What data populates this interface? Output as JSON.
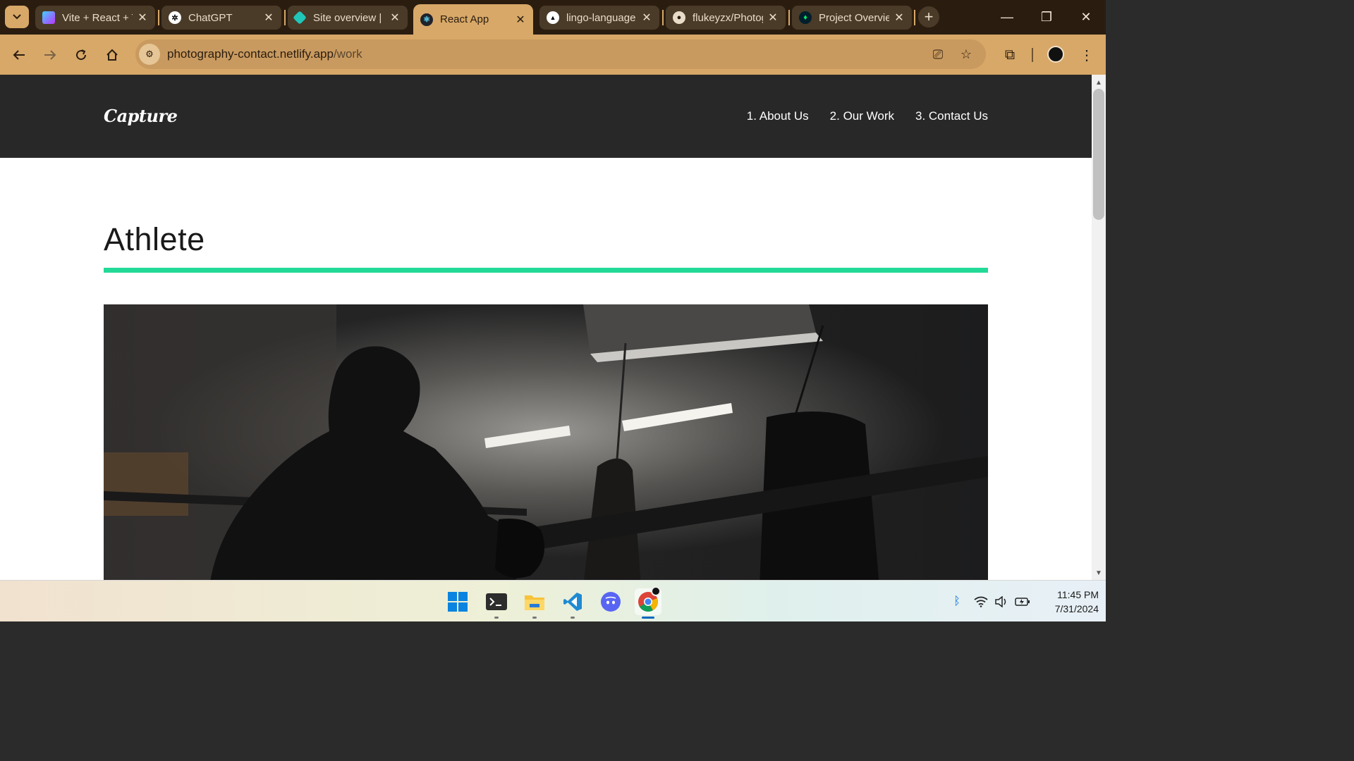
{
  "browser": {
    "tabs": [
      {
        "title": "Vite + React + TS",
        "icon": "vite-icon",
        "active": false
      },
      {
        "title": "ChatGPT",
        "icon": "chatgpt-icon",
        "active": false
      },
      {
        "title": "Site overview | Netlify",
        "icon": "netlify-icon",
        "active": false
      },
      {
        "title": "React App",
        "icon": "react-icon",
        "active": true
      },
      {
        "title": "lingo-language",
        "icon": "vercel-icon",
        "active": false
      },
      {
        "title": "flukeyzx/Photography",
        "icon": "github-icon",
        "active": false
      },
      {
        "title": "Project Overview",
        "icon": "mongodb-icon",
        "active": false
      }
    ],
    "url_host": "photography-contact.netlify.app",
    "url_path": "/work",
    "colors": {
      "frame": "#2a1d10",
      "toolbar": "#d8a868"
    }
  },
  "site": {
    "logo": "Capture",
    "nav": [
      "1. About Us",
      "2. Our Work",
      "3. Contact Us"
    ],
    "heading": "Athlete",
    "accent": "#23d997",
    "header_bg": "#282828",
    "photo": {
      "subject": "boxer-in-gym-photo"
    }
  },
  "taskbar": {
    "apps": [
      "windows-start-icon",
      "terminal-icon",
      "file-explorer-icon",
      "vscode-icon",
      "discord-icon",
      "chrome-icon"
    ],
    "time": "11:45 PM",
    "date": "7/31/2024"
  }
}
